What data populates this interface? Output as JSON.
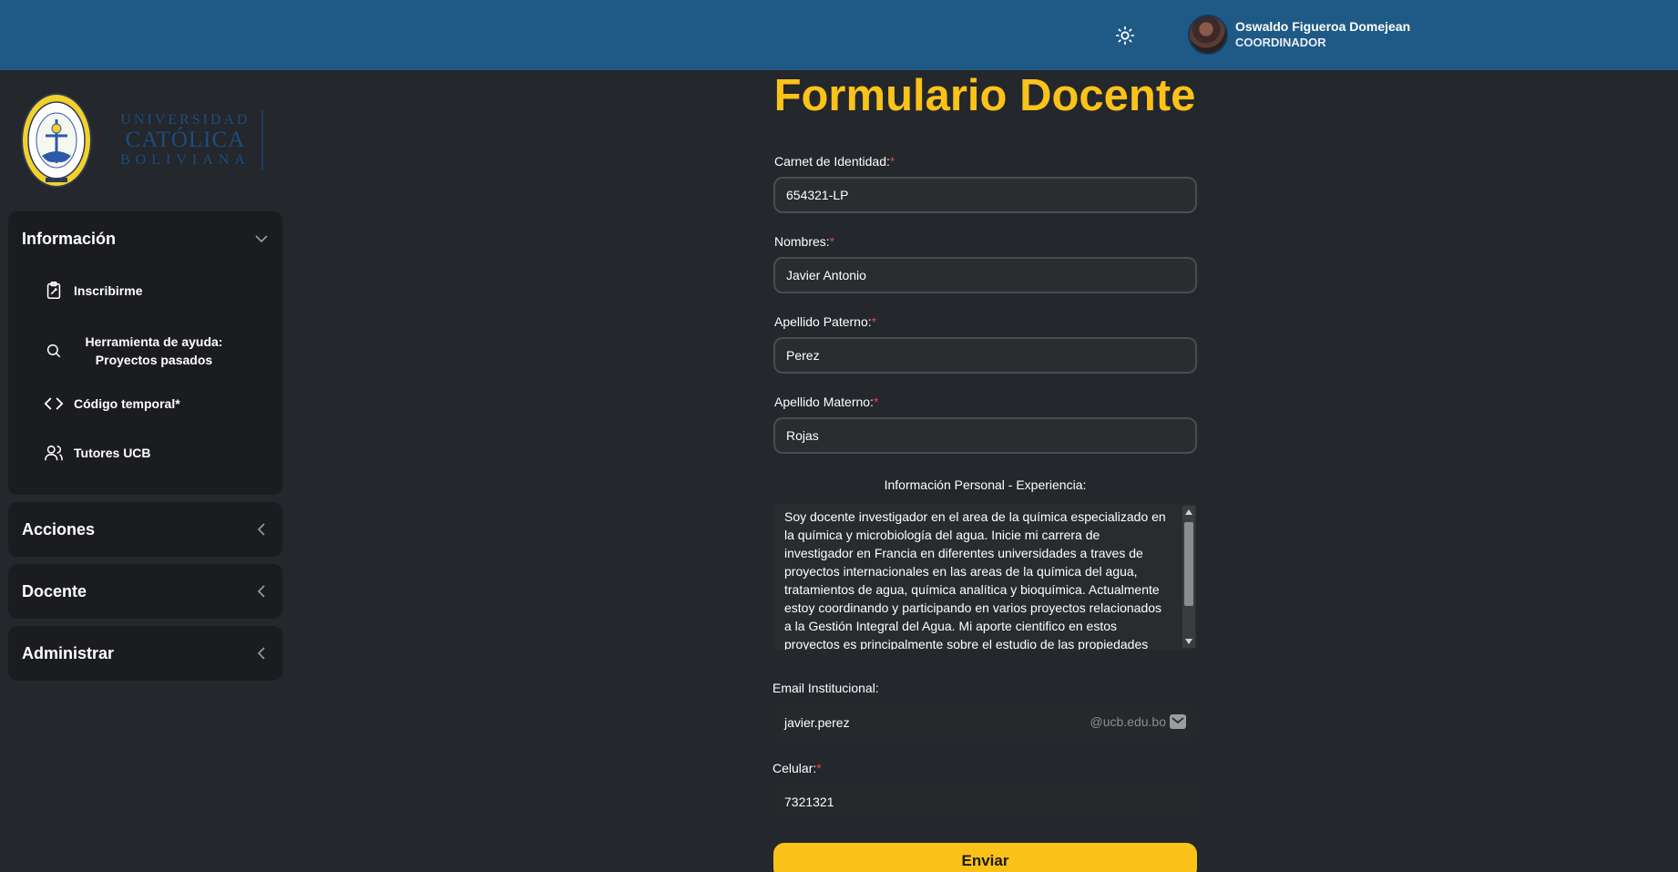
{
  "header": {
    "user_name": "Oswaldo Figueroa Domejean",
    "user_role": "COORDINADOR"
  },
  "logo": {
    "line1": "UNIVERSIDAD",
    "line2": "CATÓLICA",
    "line3": "BOLIVIANA"
  },
  "sidebar": {
    "informacion": {
      "title": "Información",
      "items": [
        {
          "label": "Inscribirme",
          "icon": "clipboard-icon"
        },
        {
          "label": "Herramienta de ayuda: Proyectos pasados",
          "icon": "search-icon"
        },
        {
          "label": "Código temporal*",
          "icon": "code-icon"
        },
        {
          "label": "Tutores UCB",
          "icon": "users-icon"
        }
      ]
    },
    "acciones": {
      "title": "Acciones"
    },
    "docente": {
      "title": "Docente"
    },
    "administrar": {
      "title": "Administrar"
    }
  },
  "form": {
    "title": "Formulario Docente",
    "ci_label": "Carnet de Identidad:",
    "ci_value": "654321-LP",
    "nombres_label": "Nombres:",
    "nombres_value": "Javier Antonio",
    "paterno_label": "Apellido Paterno:",
    "paterno_value": "Perez",
    "materno_label": "Apellido Materno:",
    "materno_value": "Rojas",
    "info_label": "Información Personal - Experiencia:",
    "info_value": "Soy docente investigador en el area de la química especializado en la química y microbiología del agua. Inicie mi carrera de investigador en Francia en diferentes universidades a traves de proyectos internacionales en las areas de la química del agua, tratamientos de agua, química analítica y bioquímica. Actualmente estoy coordinando y participando en varios proyectos relacionados a la Gestión Integral del Agua. Mi aporte cientifico en estos proyectos es principalmente sobre el estudio de las propiedades del",
    "email_label": "Email Institucional:",
    "email_value": "javier.perez",
    "email_suffix": "@ucb.edu.bo",
    "celular_label": "Celular:",
    "celular_value": "7321321",
    "required_mark": "*",
    "submit_label": "Enviar"
  },
  "colors": {
    "topbar": "#1f5a86",
    "accent": "#fbc21a",
    "background": "#24272b",
    "panel": "#1b1c1f",
    "required": "#e0464c"
  }
}
